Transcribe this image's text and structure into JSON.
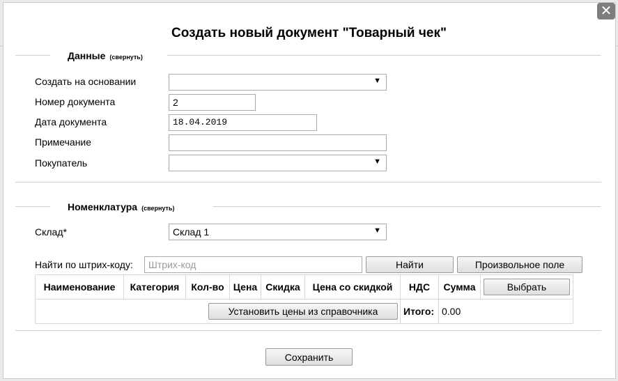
{
  "dialog": {
    "title": "Создать новый документ \"Товарный чек\"",
    "close_glyph": "✕"
  },
  "section_data": {
    "legend": "Данные",
    "collapse_link": "(свернуть)",
    "fields": {
      "base_label": "Создать на основании",
      "base_value": "",
      "number_label": "Номер документа",
      "number_value": "2",
      "date_label": "Дата документа",
      "date_value": "18.04.2019",
      "note_label": "Примечание",
      "note_value": "",
      "buyer_label": "Покупатель",
      "buyer_value": ""
    }
  },
  "section_items": {
    "legend": "Номенклатура",
    "collapse_link": "(свернуть)",
    "warehouse_label": "Склад*",
    "warehouse_value": "Склад 1",
    "barcode_label": "Найти по штрих-коду:",
    "barcode_placeholder": "Штрих-код",
    "find_button": "Найти",
    "custom_field_button": "Произвольное поле",
    "columns": [
      "Наименование",
      "Категория",
      "Кол-во",
      "Цена",
      "Скидка",
      "Цена со скидкой",
      "НДС",
      "Сумма"
    ],
    "choose_button": "Выбрать",
    "set_prices_button": "Установить цены из справочника",
    "total_label": "Итого:",
    "total_value": "0.00"
  },
  "footer": {
    "save_button": "Сохранить"
  },
  "icons": {
    "dropdown": "chevron-down-icon",
    "close": "close-icon"
  }
}
